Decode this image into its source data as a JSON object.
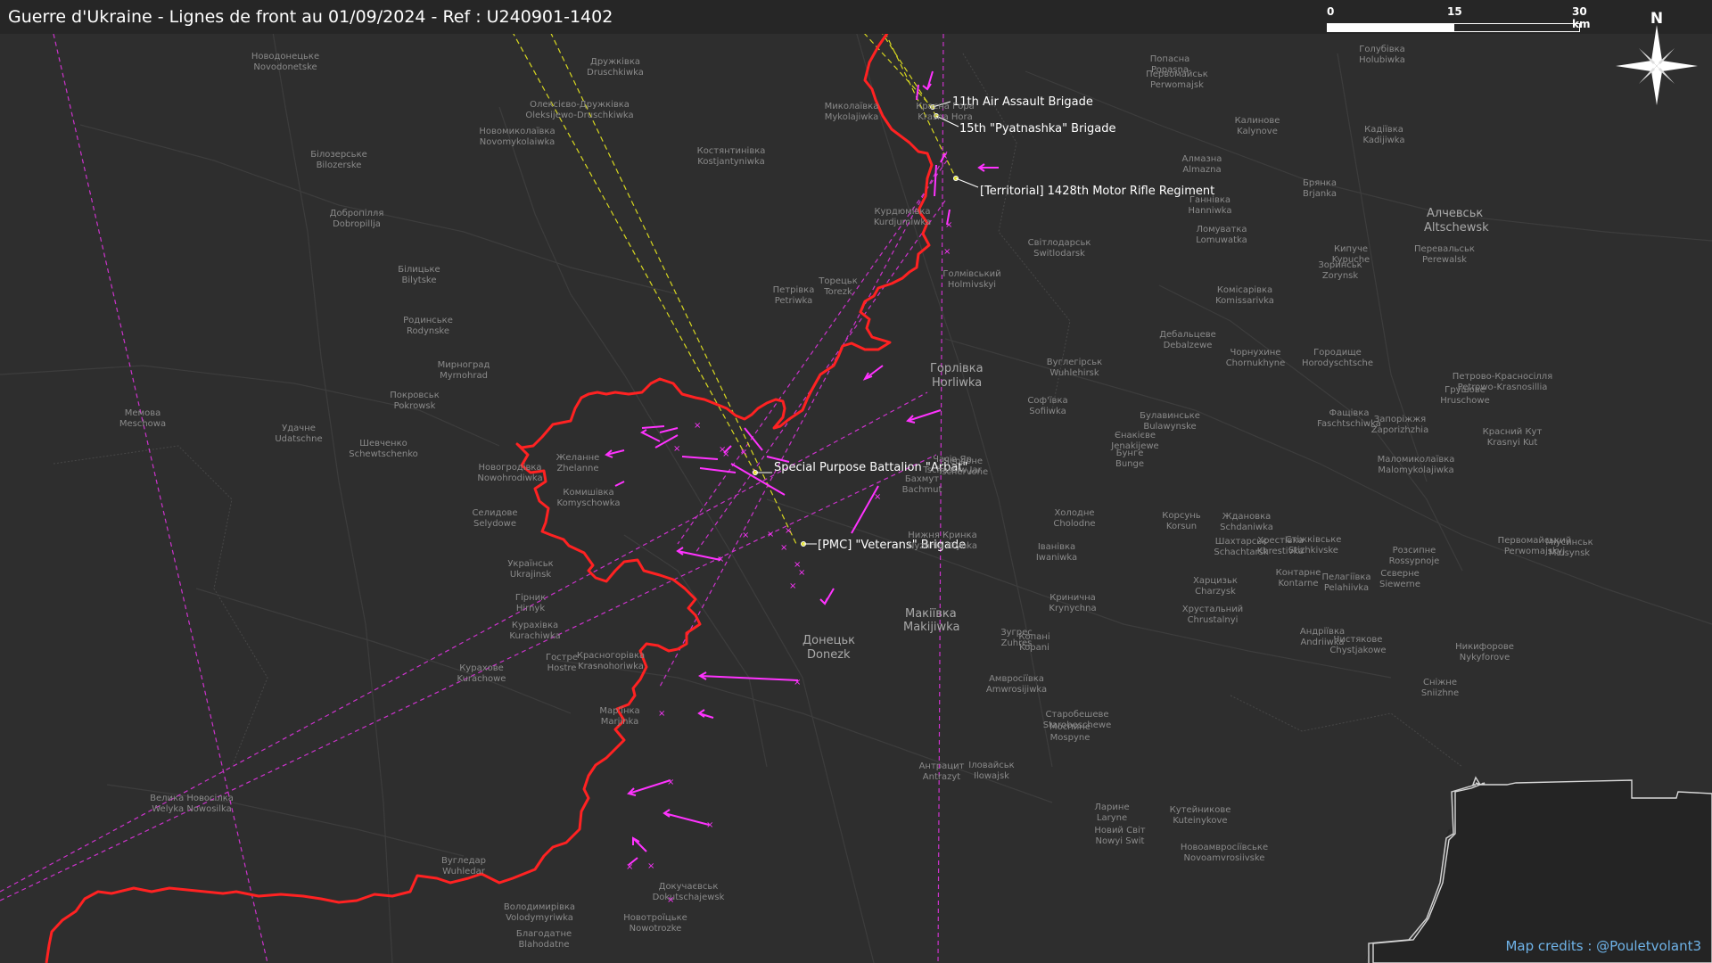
{
  "header": {
    "title": "Guerre d'Ukraine - Lignes de front au 01/09/2024 - Ref : U240901-1402"
  },
  "scale_bar": {
    "labels": [
      "0",
      "15",
      "30 km"
    ]
  },
  "north_arrow": {
    "label": "N"
  },
  "credits": "Map credits : @Pouletvolant3",
  "colors": {
    "front_line": "#ff2222",
    "arrows": "#ff33ff",
    "unit_lines": "#e0e020",
    "background": "#2e2e2e"
  },
  "units": [
    "11th Air Assault Brigade",
    "15th \"Pyatnashka\" Brigade",
    "[Territorial] 1428th Motor Rifle Regiment",
    "Special Purpose Battalion \"Arbat\"",
    "[PMC] \"Veterans\" Brigade"
  ],
  "cities": [
    [
      "Горлівка",
      "Horliwka"
    ],
    [
      "Донецьк",
      "Donezk"
    ],
    [
      "Макіївка",
      "Makijiwka"
    ],
    [
      "Алчевськ",
      "Altschewsk"
    ]
  ],
  "places": [
    [
      "Новодонецьке",
      "Novodonetske"
    ],
    [
      "Дружківка",
      "Druschkiwka"
    ],
    [
      "Олексієво-Дружківка",
      "Oleksijewo-Druschkiwka"
    ],
    [
      "Новомиколаївка",
      "Novomykolaiwka"
    ],
    [
      "Костянтинівка",
      "Kostjantyniwka"
    ],
    [
      "Білозерське",
      "Bilozerske"
    ],
    [
      "Добропілля",
      "Dobropillja"
    ],
    [
      "Білицьке",
      "Bilytske"
    ],
    [
      "Родинське",
      "Rodynske"
    ],
    [
      "Мирноград",
      "Myrnohrad"
    ],
    [
      "Покровськ",
      "Pokrowsk"
    ],
    [
      "Мемова",
      "Meschowa"
    ],
    [
      "Удачне",
      "Udatschne"
    ],
    [
      "Шевченко",
      "Schewtschenko"
    ],
    [
      "Новогродівка",
      "Nowohrodiwka"
    ],
    [
      "Желанне",
      "Zhelanne"
    ],
    [
      "Комишівка",
      "Komyschowka"
    ],
    [
      "Селидове",
      "Selydowe"
    ],
    [
      "Українськ",
      "Ukrajinsk"
    ],
    [
      "Гірник",
      "Hirnyk"
    ],
    [
      "Курахівка",
      "Kurachiwka"
    ],
    [
      "Курахове",
      "Kurachowe"
    ],
    [
      "Гостре",
      "Hostre"
    ],
    [
      "Красногорівка",
      "Krasnohoriwka"
    ],
    [
      "Мар'їнка",
      "Marjinka"
    ],
    [
      "Велика Новосілка",
      "Welyka Nowosilka"
    ],
    [
      "Вугледар",
      "Wuhledar"
    ],
    [
      "Володимирівка",
      "Volodymyriwka"
    ],
    [
      "Благодатне",
      "Blahodatne"
    ],
    [
      "Новотроїцьке",
      "Nowotrozke"
    ],
    [
      "Докучаєвськ",
      "Dokutschajewsk"
    ],
    [
      "Торецьк",
      "Torezk"
    ],
    [
      "Петрівка",
      "Petriwka"
    ],
    [
      "Курдюмівка",
      "Kurdjumiwka"
    ],
    [
      "Голмівський",
      "Holmivskyi"
    ],
    [
      "Світлодарськ",
      "Switlodarsk"
    ],
    [
      "Попасна",
      "Popasna"
    ],
    [
      "Первомайськ",
      "Perwomajsk"
    ],
    [
      "Голубівка",
      "Holubiwka"
    ],
    [
      "Калинове",
      "Kalynove"
    ],
    [
      "Кадіївка",
      "Kadijiwka"
    ],
    [
      "Алмазна",
      "Almazna"
    ],
    [
      "Брянка",
      "Brjanka"
    ],
    [
      "Ганнівка",
      "Hanniwka"
    ],
    [
      "Ломуватка",
      "Lomuwatka"
    ],
    [
      "Зоринськ",
      "Zorynsk"
    ],
    [
      "Кипуче",
      "Kypuche"
    ],
    [
      "Перевальськ",
      "Perewalsk"
    ],
    [
      "Комісарівка",
      "Komissarivka"
    ],
    [
      "Дебальцеве",
      "Debalzewe"
    ],
    [
      "Чорнухине",
      "Chornukhyne"
    ],
    [
      "Городище",
      "Horodyschtsche"
    ],
    [
      "Вуглегірськ",
      "Wuhlehirsk"
    ],
    [
      "Соф'ївка",
      "Sofiiwka"
    ],
    [
      "Булавинське",
      "Bulawynske"
    ],
    [
      "Єнакієве",
      "Jenakijewe"
    ],
    [
      "Бунге",
      "Bunge"
    ],
    [
      "Корсунь",
      "Korsun"
    ],
    [
      "Ждановка",
      "Schdaniwka"
    ],
    [
      "Хрестівка",
      "Khrestivka"
    ],
    [
      "Стіжківське",
      "Stizhkivske"
    ],
    [
      "Розсипне",
      "Rossypnoje"
    ],
    [
      "Фащівка",
      "Faschtschiwka"
    ],
    [
      "Запоріжжя",
      "Zaporizhzhia"
    ],
    [
      "Грушове",
      "Hruschowe"
    ],
    [
      "Петрово-Красносілля",
      "Petrowo-Krasnosillia"
    ],
    [
      "Маломиколаївка",
      "Malomykolajiwka"
    ],
    [
      "Красний Кут",
      "Krasnyi Kut"
    ],
    [
      "Іванівка",
      "Iwaniwka"
    ],
    [
      "Нижня Кринка",
      "Nyzhnia Krynka"
    ],
    [
      "Кринична",
      "Krynychna"
    ],
    [
      "Зугрес",
      "Zuhres"
    ],
    [
      "Харцизьк",
      "Charzysk"
    ],
    [
      "Шахтарськ",
      "Schachtarsk"
    ],
    [
      "Контарне",
      "Kontarne"
    ],
    [
      "Пелагіївка",
      "Pelahiivka"
    ],
    [
      "Сєверне",
      "Siewerne"
    ],
    [
      "Андріївка",
      "Andriiwka"
    ],
    [
      "Чистякове",
      "Chystjakowe"
    ],
    [
      "Сніжне",
      "Sniizhne"
    ],
    [
      "Никифорове",
      "Nykyforove"
    ],
    [
      "Первомайський",
      "Perwomajskyj"
    ],
    [
      "Міусинськ",
      "Miusynsk"
    ],
    [
      "Хрустальний",
      "Chrustalnyi"
    ],
    [
      "Антрацит",
      "Antrazyt"
    ],
    [
      "Іловайськ",
      "Ilowajsk"
    ],
    [
      "Моспине",
      "Mospyne"
    ],
    [
      "Ларине",
      "Larynе"
    ],
    [
      "Новий Світ",
      "Nowyi Swit"
    ],
    [
      "Кутейникове",
      "Kuteinykove"
    ],
    [
      "Новоамвросіївське",
      "Novoamvrosiivske"
    ],
    [
      "Амвросіївка",
      "Amwrosijiwka"
    ],
    [
      "Старобешеве",
      "Starobeschewe"
    ],
    [
      "Копані",
      "Kopani"
    ],
    [
      "Холодне",
      "Cholodne"
    ],
    [
      "Червоне",
      "Tschervone"
    ],
    [
      "Бахмут",
      "Bachmut"
    ],
    [
      "Часів Яр",
      "Tschassiw Jar"
    ],
    [
      "Красна Гора",
      "Krasna Hora"
    ],
    [
      "Миколаївка",
      "Mykolajiwka"
    ]
  ]
}
